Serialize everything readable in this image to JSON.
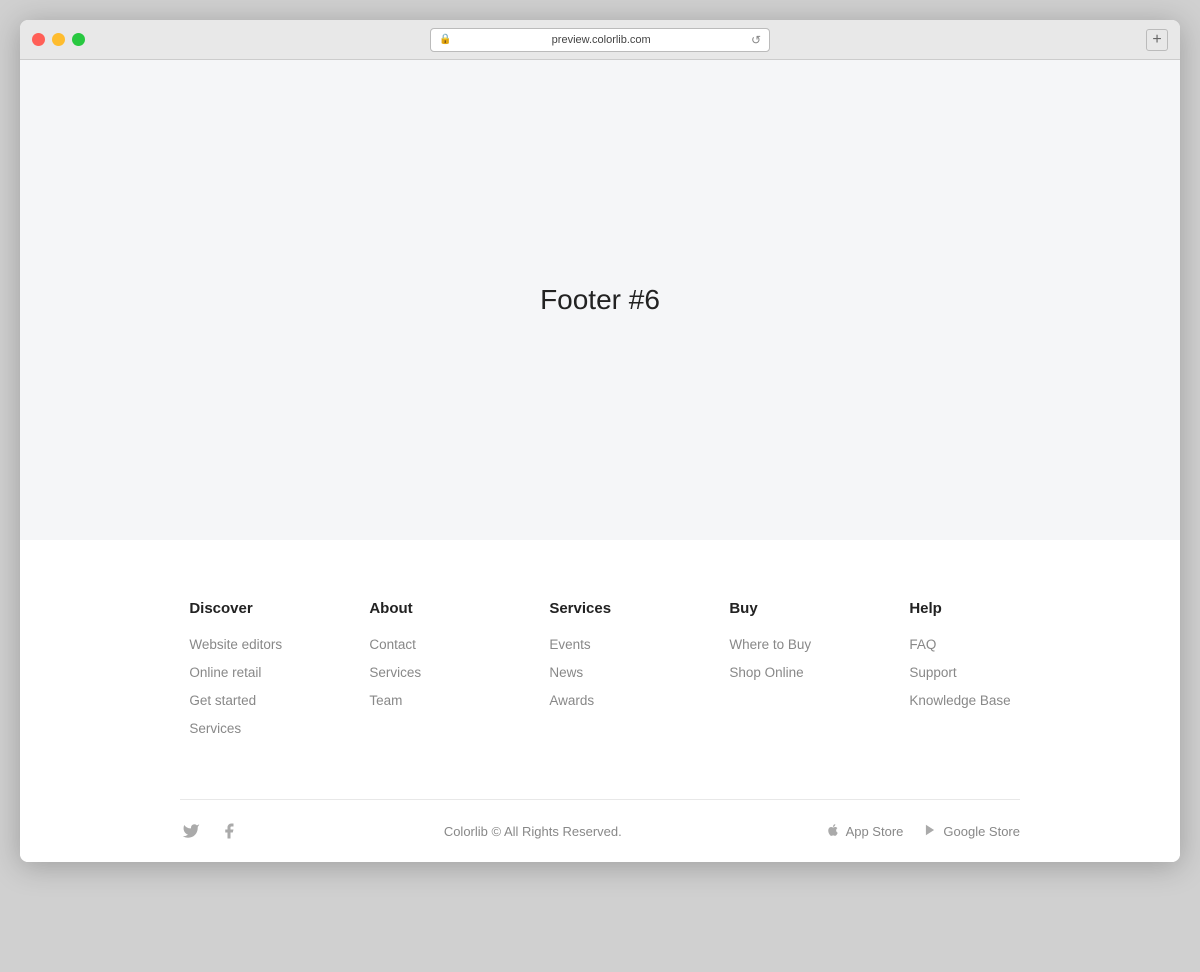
{
  "browser": {
    "url": "preview.colorlib.com",
    "new_tab_label": "+",
    "lock_icon": "🔒",
    "refresh_icon": "↺"
  },
  "page": {
    "title": "Footer #6"
  },
  "footer": {
    "columns": [
      {
        "id": "discover",
        "heading": "Discover",
        "links": [
          "Website editors",
          "Online retail",
          "Get started",
          "Services"
        ]
      },
      {
        "id": "about",
        "heading": "About",
        "links": [
          "Contact",
          "Services",
          "Team"
        ]
      },
      {
        "id": "services",
        "heading": "Services",
        "links": [
          "Events",
          "News",
          "Awards"
        ]
      },
      {
        "id": "buy",
        "heading": "Buy",
        "links": [
          "Where to Buy",
          "Shop Online"
        ]
      },
      {
        "id": "help",
        "heading": "Help",
        "links": [
          "FAQ",
          "Support",
          "Knowledge Base"
        ]
      }
    ],
    "copyright": "Colorlib © All Rights Reserved.",
    "social": {
      "twitter_icon": "𝕏",
      "facebook_icon": "f"
    },
    "stores": [
      {
        "id": "app-store",
        "icon": "apple",
        "label": "App Store"
      },
      {
        "id": "google-store",
        "icon": "play",
        "label": "Google Store"
      }
    ]
  }
}
